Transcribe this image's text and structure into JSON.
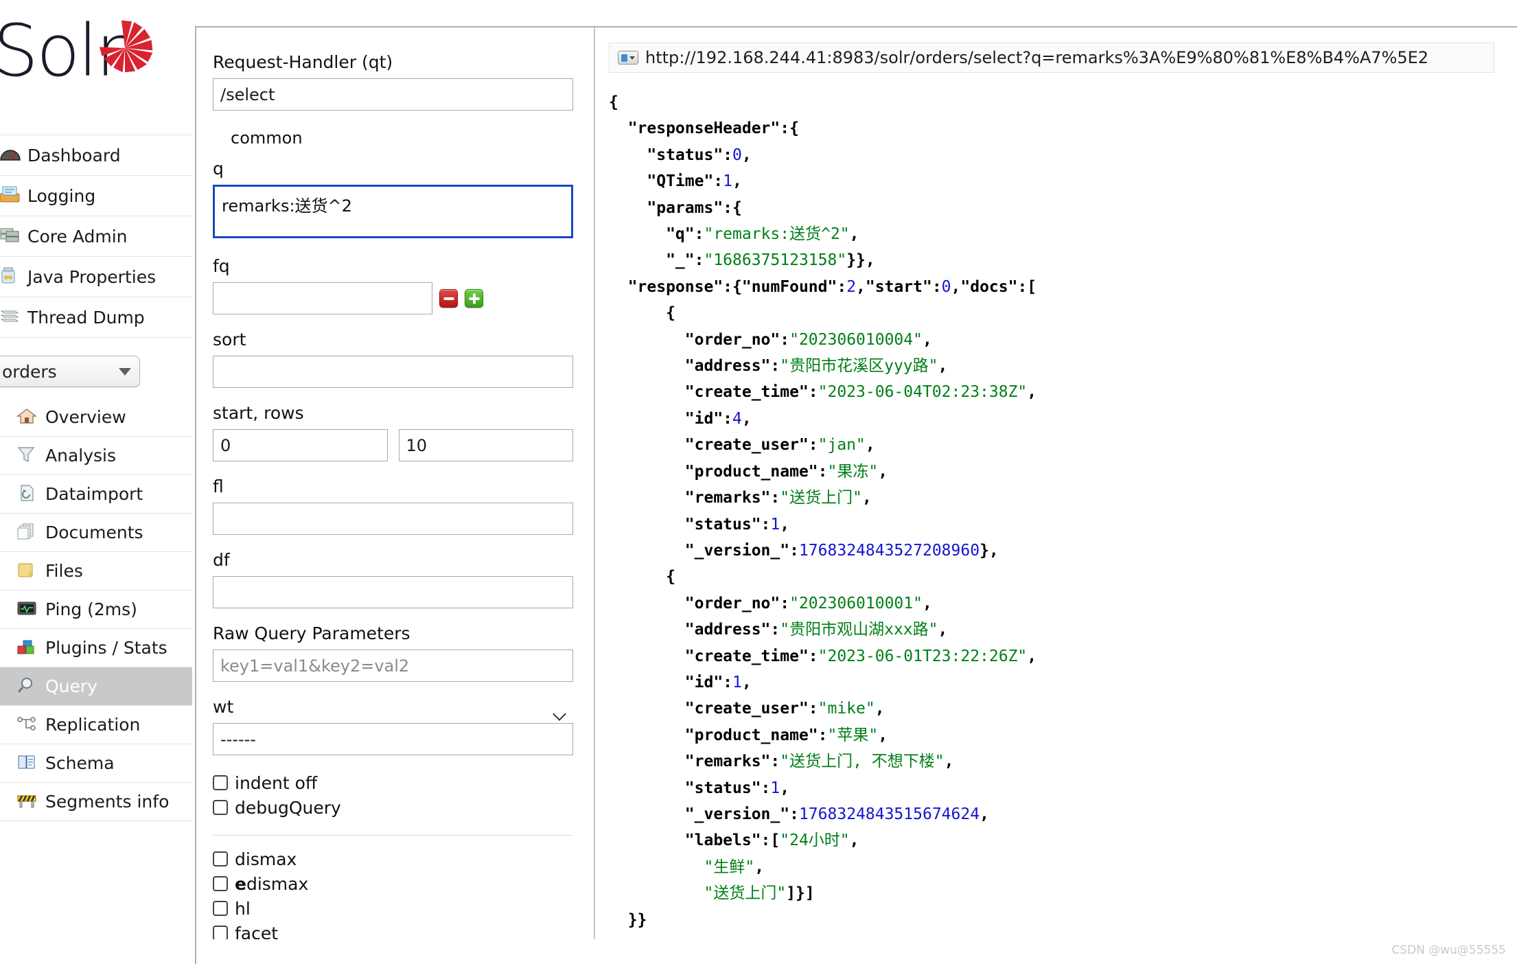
{
  "brand": {
    "name": "Solr",
    "logo_icon": "solr-sunburst-logo"
  },
  "sidebar": {
    "global_items": [
      {
        "label": "Dashboard",
        "icon": "dashboard-icon"
      },
      {
        "label": "Logging",
        "icon": "logging-icon"
      },
      {
        "label": "Core Admin",
        "icon": "core-admin-icon"
      },
      {
        "label": "Java Properties",
        "icon": "java-properties-icon"
      },
      {
        "label": "Thread Dump",
        "icon": "thread-dump-icon"
      }
    ],
    "core_selector": {
      "value": "orders",
      "arrow_icon": "chevron-down-icon"
    },
    "core_items": [
      {
        "label": "Overview",
        "icon": "home-icon",
        "selected": false
      },
      {
        "label": "Analysis",
        "icon": "funnel-icon",
        "selected": false
      },
      {
        "label": "Dataimport",
        "icon": "dataimport-icon",
        "selected": false
      },
      {
        "label": "Documents",
        "icon": "documents-icon",
        "selected": false
      },
      {
        "label": "Files",
        "icon": "folder-icon",
        "selected": false
      },
      {
        "label": "Ping (2ms)",
        "icon": "ping-icon",
        "selected": false
      },
      {
        "label": "Plugins / Stats",
        "icon": "plugins-icon",
        "selected": false
      },
      {
        "label": "Query",
        "icon": "magnifier-icon",
        "selected": true
      },
      {
        "label": "Replication",
        "icon": "replication-icon",
        "selected": false
      },
      {
        "label": "Schema",
        "icon": "schema-book-icon",
        "selected": false
      },
      {
        "label": "Segments info",
        "icon": "segments-icon",
        "selected": false
      }
    ]
  },
  "query_form": {
    "request_handler": {
      "label": "Request-Handler (qt)",
      "value": "/select"
    },
    "fieldset_legend": "common",
    "q": {
      "label": "q",
      "value": "remarks:送货^2",
      "focused": true
    },
    "fq": {
      "label": "fq",
      "value": "",
      "remove_icon": "minus-button",
      "add_icon": "plus-button"
    },
    "sort": {
      "label": "sort",
      "value": ""
    },
    "start_rows": {
      "label": "start, rows",
      "start": "0",
      "rows": "10"
    },
    "fl": {
      "label": "fl",
      "value": ""
    },
    "df": {
      "label": "df",
      "value": ""
    },
    "raw_query_parameters": {
      "label": "Raw Query Parameters",
      "placeholder": "key1=val1&key2=val2",
      "value": ""
    },
    "wt": {
      "label": "wt",
      "value": "------",
      "chevron_icon": "chevron-down-icon"
    },
    "checkboxes_primary": [
      {
        "label": "indent off",
        "checked": false
      },
      {
        "label": "debugQuery",
        "checked": false
      }
    ],
    "checkboxes_secondary": [
      {
        "label": "dismax",
        "checked": false,
        "bold_prefix": ""
      },
      {
        "label": "dismax",
        "checked": false,
        "bold_prefix": "e"
      },
      {
        "label": "hl",
        "checked": false,
        "bold_prefix": ""
      },
      {
        "label": "facet",
        "checked": false,
        "bold_prefix": ""
      }
    ]
  },
  "response_panel": {
    "url": "http://192.168.244.41:8983/solr/orders/select?q=remarks%3A%E9%80%81%E8%B4%A7%5E2",
    "url_icon": "page-dropdown-icon",
    "json_lines": [
      [
        {
          "t": "{",
          "c": "jp"
        }
      ],
      [
        {
          "t": "  \"responseHeader\":{",
          "c": "jk"
        }
      ],
      [
        {
          "t": "    \"status\":",
          "c": "jk"
        },
        {
          "t": "0",
          "c": "jn"
        },
        {
          "t": ",",
          "c": "jp"
        }
      ],
      [
        {
          "t": "    \"QTime\":",
          "c": "jk"
        },
        {
          "t": "1",
          "c": "jn"
        },
        {
          "t": ",",
          "c": "jp"
        }
      ],
      [
        {
          "t": "    \"params\":{",
          "c": "jk"
        }
      ],
      [
        {
          "t": "      \"q\":",
          "c": "jk"
        },
        {
          "t": "\"remarks:送货^2\"",
          "c": "js"
        },
        {
          "t": ",",
          "c": "jp"
        }
      ],
      [
        {
          "t": "      \"_\":",
          "c": "jk"
        },
        {
          "t": "\"1686375123158\"",
          "c": "js"
        },
        {
          "t": "}},",
          "c": "jp"
        }
      ],
      [
        {
          "t": "  \"response\":{\"numFound\":",
          "c": "jk"
        },
        {
          "t": "2",
          "c": "jn"
        },
        {
          "t": ",\"start\":",
          "c": "jk"
        },
        {
          "t": "0",
          "c": "jn"
        },
        {
          "t": ",\"docs\":[",
          "c": "jk"
        }
      ],
      [
        {
          "t": "      {",
          "c": "jp"
        }
      ],
      [
        {
          "t": "        \"order_no\":",
          "c": "jk"
        },
        {
          "t": "\"202306010004\"",
          "c": "js"
        },
        {
          "t": ",",
          "c": "jp"
        }
      ],
      [
        {
          "t": "        \"address\":",
          "c": "jk"
        },
        {
          "t": "\"贵阳市花溪区yyy路\"",
          "c": "js"
        },
        {
          "t": ",",
          "c": "jp"
        }
      ],
      [
        {
          "t": "        \"create_time\":",
          "c": "jk"
        },
        {
          "t": "\"2023-06-04T02:23:38Z\"",
          "c": "js"
        },
        {
          "t": ",",
          "c": "jp"
        }
      ],
      [
        {
          "t": "        \"id\":",
          "c": "jk"
        },
        {
          "t": "4",
          "c": "jn"
        },
        {
          "t": ",",
          "c": "jp"
        }
      ],
      [
        {
          "t": "        \"create_user\":",
          "c": "jk"
        },
        {
          "t": "\"jan\"",
          "c": "js"
        },
        {
          "t": ",",
          "c": "jp"
        }
      ],
      [
        {
          "t": "        \"product_name\":",
          "c": "jk"
        },
        {
          "t": "\"果冻\"",
          "c": "js"
        },
        {
          "t": ",",
          "c": "jp"
        }
      ],
      [
        {
          "t": "        \"remarks\":",
          "c": "jk"
        },
        {
          "t": "\"送货上门\"",
          "c": "js"
        },
        {
          "t": ",",
          "c": "jp"
        }
      ],
      [
        {
          "t": "        \"status\":",
          "c": "jk"
        },
        {
          "t": "1",
          "c": "jn"
        },
        {
          "t": ",",
          "c": "jp"
        }
      ],
      [
        {
          "t": "        \"_version_\":",
          "c": "jk"
        },
        {
          "t": "1768324843527208960",
          "c": "jn"
        },
        {
          "t": "},",
          "c": "jp"
        }
      ],
      [
        {
          "t": "      {",
          "c": "jp"
        }
      ],
      [
        {
          "t": "        \"order_no\":",
          "c": "jk"
        },
        {
          "t": "\"202306010001\"",
          "c": "js"
        },
        {
          "t": ",",
          "c": "jp"
        }
      ],
      [
        {
          "t": "        \"address\":",
          "c": "jk"
        },
        {
          "t": "\"贵阳市观山湖xxx路\"",
          "c": "js"
        },
        {
          "t": ",",
          "c": "jp"
        }
      ],
      [
        {
          "t": "        \"create_time\":",
          "c": "jk"
        },
        {
          "t": "\"2023-06-01T23:22:26Z\"",
          "c": "js"
        },
        {
          "t": ",",
          "c": "jp"
        }
      ],
      [
        {
          "t": "        \"id\":",
          "c": "jk"
        },
        {
          "t": "1",
          "c": "jn"
        },
        {
          "t": ",",
          "c": "jp"
        }
      ],
      [
        {
          "t": "        \"create_user\":",
          "c": "jk"
        },
        {
          "t": "\"mike\"",
          "c": "js"
        },
        {
          "t": ",",
          "c": "jp"
        }
      ],
      [
        {
          "t": "        \"product_name\":",
          "c": "jk"
        },
        {
          "t": "\"苹果\"",
          "c": "js"
        },
        {
          "t": ",",
          "c": "jp"
        }
      ],
      [
        {
          "t": "        \"remarks\":",
          "c": "jk"
        },
        {
          "t": "\"送货上门, 不想下楼\"",
          "c": "js"
        },
        {
          "t": ",",
          "c": "jp"
        }
      ],
      [
        {
          "t": "        \"status\":",
          "c": "jk"
        },
        {
          "t": "1",
          "c": "jn"
        },
        {
          "t": ",",
          "c": "jp"
        }
      ],
      [
        {
          "t": "        \"_version_\":",
          "c": "jk"
        },
        {
          "t": "1768324843515674624",
          "c": "jn"
        },
        {
          "t": ",",
          "c": "jp"
        }
      ],
      [
        {
          "t": "        \"labels\":[",
          "c": "jk"
        },
        {
          "t": "\"24小时\"",
          "c": "js"
        },
        {
          "t": ",",
          "c": "jp"
        }
      ],
      [
        {
          "t": "          ",
          "c": "jp"
        },
        {
          "t": "\"生鲜\"",
          "c": "js"
        },
        {
          "t": ",",
          "c": "jp"
        }
      ],
      [
        {
          "t": "          ",
          "c": "jp"
        },
        {
          "t": "\"送货上门\"",
          "c": "js"
        },
        {
          "t": "]}]",
          "c": "jp"
        }
      ],
      [
        {
          "t": "  }}",
          "c": "jp"
        }
      ]
    ]
  },
  "watermark": "CSDN @wu@55555"
}
